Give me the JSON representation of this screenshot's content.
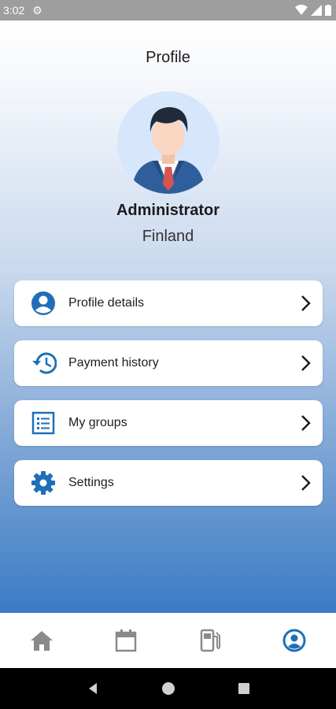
{
  "status_bar": {
    "time": "3:02"
  },
  "header": {
    "title": "Profile"
  },
  "profile": {
    "name": "Administrator",
    "country": "Finland"
  },
  "menu": [
    {
      "label": "Profile details",
      "icon": "account-circle-icon"
    },
    {
      "label": "Payment history",
      "icon": "history-icon"
    },
    {
      "label": "My groups",
      "icon": "list-icon"
    },
    {
      "label": "Settings",
      "icon": "gear-icon"
    }
  ],
  "bottom_nav": [
    {
      "icon": "home-icon",
      "active": false
    },
    {
      "icon": "calendar-icon",
      "active": false
    },
    {
      "icon": "fuel-station-icon",
      "active": false
    },
    {
      "icon": "profile-icon",
      "active": true
    }
  ],
  "colors": {
    "accent": "#1f6fb8",
    "inactive": "#8a8a8a"
  }
}
